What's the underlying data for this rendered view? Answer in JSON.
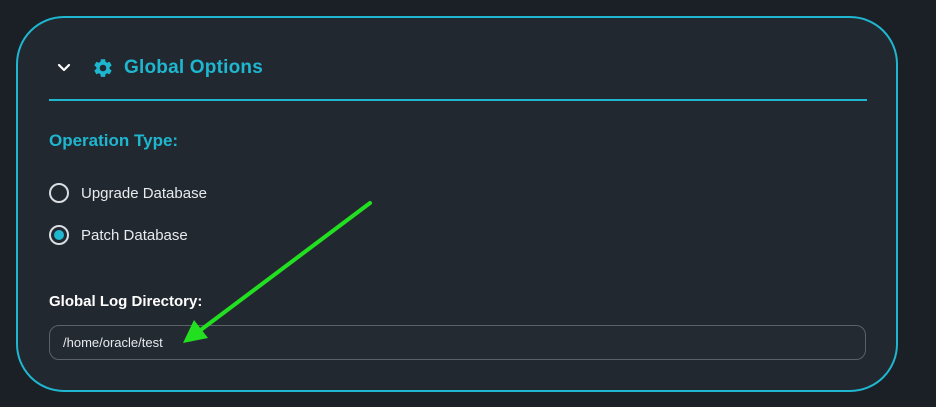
{
  "panel": {
    "title": "Global Options",
    "icon": "gear-icon",
    "toggle_icon": "chevron-down-icon",
    "expanded": true
  },
  "operation": {
    "label": "Operation Type:",
    "options": [
      {
        "label": "Upgrade Database",
        "selected": false
      },
      {
        "label": "Patch Database",
        "selected": true
      }
    ]
  },
  "log_directory": {
    "label": "Global Log Directory:",
    "value": "/home/oracle/test"
  },
  "colors": {
    "accent": "#1fb6cf",
    "background": "#1b1f26",
    "card": "#222830",
    "annotation_arrow": "#22e01f"
  }
}
